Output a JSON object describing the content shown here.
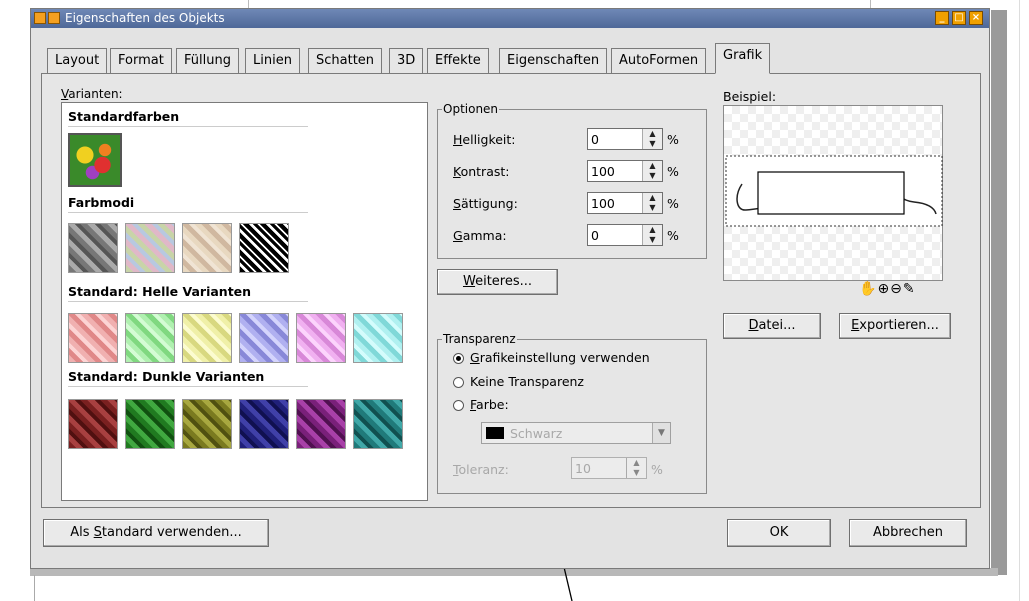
{
  "window": {
    "title": "Eigenschaften des Objekts"
  },
  "tabs": [
    {
      "label": "Layout"
    },
    {
      "label": "Format"
    },
    {
      "label": "Füllung"
    },
    {
      "label": "Linien"
    },
    {
      "label": "Schatten"
    },
    {
      "label": "3D"
    },
    {
      "label": "Effekte"
    },
    {
      "label": "Eigenschaften"
    },
    {
      "label": "AutoFormen"
    },
    {
      "label": "Grafik"
    }
  ],
  "active_tab": "Grafik",
  "variants": {
    "label_pre": "",
    "label_key": "V",
    "label_post": "arianten:",
    "groups": [
      {
        "title": "Standardfarben"
      },
      {
        "title": "Farbmodi"
      },
      {
        "title": "Standard: Helle Varianten"
      },
      {
        "title": "Standard: Dunkle Varianten"
      }
    ]
  },
  "optionen": {
    "legend": "Optionen",
    "rows": [
      {
        "key": "H",
        "rest": "elligkeit:",
        "value": "0",
        "unit": "%"
      },
      {
        "key": "K",
        "rest": "ontrast:",
        "value": "100",
        "unit": "%"
      },
      {
        "key": "S",
        "rest": "ättigung:",
        "value": "100",
        "unit": "%"
      },
      {
        "key": "G",
        "rest": "amma:",
        "value": "0",
        "unit": "%"
      }
    ]
  },
  "weiteres": {
    "key": "W",
    "rest": "eiteres..."
  },
  "transparenz": {
    "legend": "Transparenz",
    "options": [
      {
        "key": "G",
        "rest": "rafikeinstellung verwenden",
        "selected": true
      },
      {
        "pre": "Keine Transparenz",
        "selected": false
      },
      {
        "key": "F",
        "rest": "arbe:",
        "selected": false
      }
    ],
    "color_value": "Schwarz",
    "toleranz": {
      "key": "T",
      "rest": "oleranz:",
      "value": "10",
      "unit": "%"
    }
  },
  "preview": {
    "label": "Beispiel:"
  },
  "buttons": {
    "datei": {
      "key": "D",
      "rest": "atei..."
    },
    "export": {
      "key": "E",
      "rest": "xportieren..."
    },
    "standard": {
      "pre": "Als ",
      "key": "S",
      "rest": "tandard verwenden..."
    },
    "ok": "OK",
    "abbrechen": "Abbrechen"
  },
  "colors": {
    "titlebar": "#5a74a6",
    "dialog_bg": "#e6e6e6",
    "title_button": "#f0a000"
  }
}
